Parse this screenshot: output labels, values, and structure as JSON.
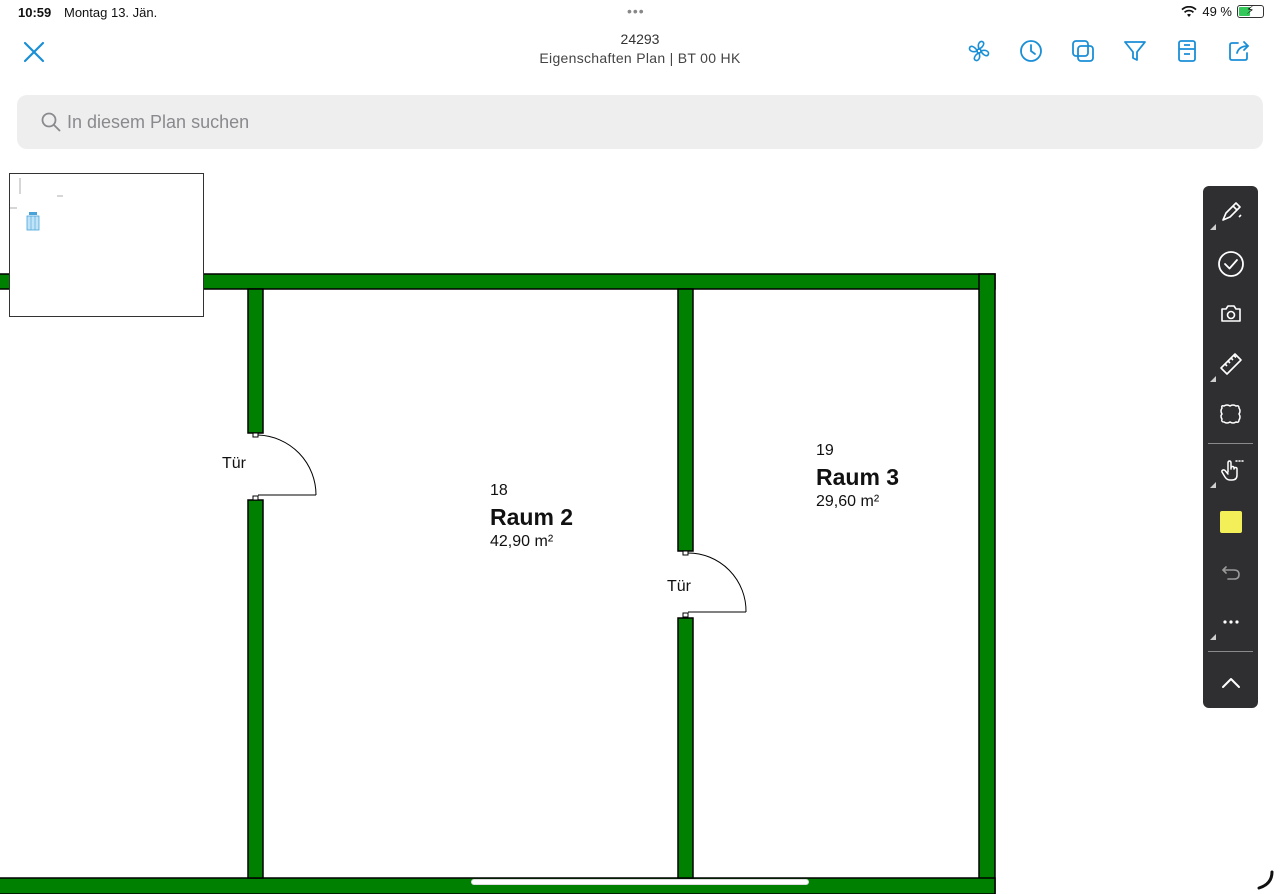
{
  "status": {
    "time": "10:59",
    "date": "Montag 13. Jän.",
    "dots": "•••",
    "battery": "49 %"
  },
  "header": {
    "plan_id": "24293",
    "subtitle": "Eigenschaften Plan | BT 00 HK"
  },
  "search": {
    "placeholder": "In diesem Plan suchen"
  },
  "plan": {
    "rooms": [
      {
        "number": "18",
        "name": "Raum 2",
        "area": "42,90 m²"
      },
      {
        "number": "19",
        "name": "Raum 3",
        "area": "29,60 m²"
      }
    ],
    "doors": [
      {
        "label": "Tür"
      },
      {
        "label": "Tür"
      }
    ],
    "wall_color": "#008000",
    "wall_outline_color": "#000000"
  },
  "colors": {
    "accent": "#1a8fd6",
    "panel_bg": "#2f2f31",
    "marker_color": "#f2ef58"
  },
  "icons": [
    "close-icon",
    "fan-icon",
    "clock-icon",
    "layers-icon",
    "filter-icon",
    "sheet-icon",
    "share-icon",
    "search-icon",
    "pen-icon",
    "checkmark-icon",
    "camera-icon",
    "ruler-icon",
    "cloud-shape-icon",
    "hand-pointer-icon",
    "undo-icon",
    "more-icon",
    "chevron-up-icon"
  ]
}
